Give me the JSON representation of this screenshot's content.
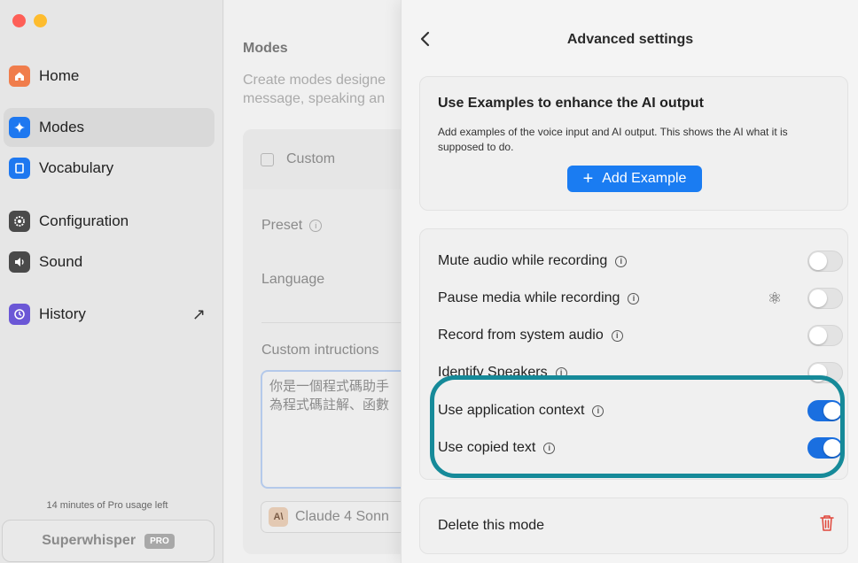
{
  "sidebar": {
    "items": [
      {
        "label": "Home",
        "icon": "home-icon",
        "color": "#f07d4c"
      },
      {
        "label": "Modes",
        "icon": "sparkle-icon",
        "color": "#1e78f0"
      },
      {
        "label": "Vocabulary",
        "icon": "book-icon",
        "color": "#1e78f0"
      },
      {
        "label": "Configuration",
        "icon": "gear-icon",
        "color": "#4a4a4a"
      },
      {
        "label": "Sound",
        "icon": "speaker-icon",
        "color": "#4a4a4a"
      },
      {
        "label": "History",
        "icon": "history-icon",
        "color": "#6b57d6"
      }
    ],
    "usage_text": "14 minutes of Pro usage left",
    "app_name": "Superwhisper",
    "badge": "PRO"
  },
  "main": {
    "title": "Modes",
    "description_line1": "Create modes designe",
    "description_line2": "message, speaking an",
    "custom_label": "Custom",
    "preset_label": "Preset",
    "language_label": "Language",
    "instructions_label": "Custom intructions",
    "instructions_text": "你是一個程式碼助手\n為程式碼註解、函數",
    "model_icon_text": "A\\",
    "model_name": "Claude 4 Sonn"
  },
  "panel": {
    "title": "Advanced settings",
    "examples": {
      "title": "Use Examples to enhance the AI output",
      "description": "Add examples of the voice input and AI output. This shows the AI what it is supposed to do.",
      "button": "Add Example"
    },
    "settings": [
      {
        "label": "Mute audio while recording",
        "on": false
      },
      {
        "label": "Pause media while recording",
        "on": false
      },
      {
        "label": "Record from system audio",
        "on": false
      },
      {
        "label": "Identify Speakers",
        "on": false
      },
      {
        "label": "Use application context",
        "on": true
      },
      {
        "label": "Use copied text",
        "on": true
      }
    ],
    "delete_label": "Delete this mode"
  }
}
